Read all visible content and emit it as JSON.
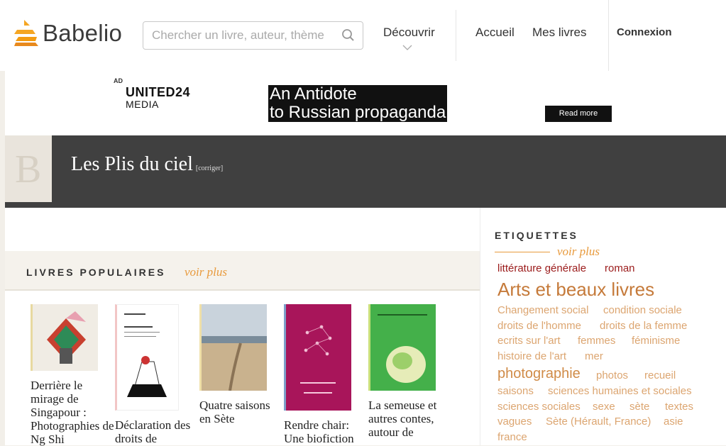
{
  "header": {
    "logo_text": "Babelio",
    "search_placeholder": "Chercher un livre, auteur, thème",
    "nav": {
      "decouvrir": "Découvrir",
      "accueil": "Accueil",
      "mes_livres": "Mes livres",
      "connexion": "Connexion"
    }
  },
  "ad": {
    "label": "AD",
    "brand_line1": "UNITED24",
    "brand_line2": "MEDIA",
    "headline_line1": "An Antidote",
    "headline_line2": "to Russian propaganda",
    "button": "Read more"
  },
  "book": {
    "cover_letter": "B",
    "title": "Les Plis du ciel",
    "corriger": "[corriger]"
  },
  "popular": {
    "title": "LIVRES POPULAIRES",
    "voir_plus": "voir plus",
    "books": [
      {
        "title": "Derrière le mirage de Singapour : Photographies de Ng Shi"
      },
      {
        "title": "Déclaration des droits de"
      },
      {
        "title": "Quatre saisons en Sète"
      },
      {
        "title": "Rendre chair: Une biofiction"
      },
      {
        "title": "La semeuse et autres contes, autour de"
      }
    ]
  },
  "tags": {
    "title": "ETIQUETTES",
    "voir_plus": "voir plus",
    "items": [
      "littérature générale",
      "roman",
      "Arts et beaux livres",
      "Changement social",
      "condition sociale",
      "droits de l'homme",
      "droits de la femme",
      "ecrits sur l'art",
      "femmes",
      "féminisme",
      "histoire de l'art",
      "mer",
      "photographie",
      "photos",
      "recueil",
      "saisons",
      "sciences humaines et sociales",
      "sciences sociales",
      "sexe",
      "sète",
      "textes",
      "vagues",
      "Sète (Hérault, France)",
      "asie",
      "france"
    ]
  },
  "colors": {
    "accent": "#e89a3c",
    "title_band": "#404040",
    "tag_red": "#9b1b1b"
  }
}
